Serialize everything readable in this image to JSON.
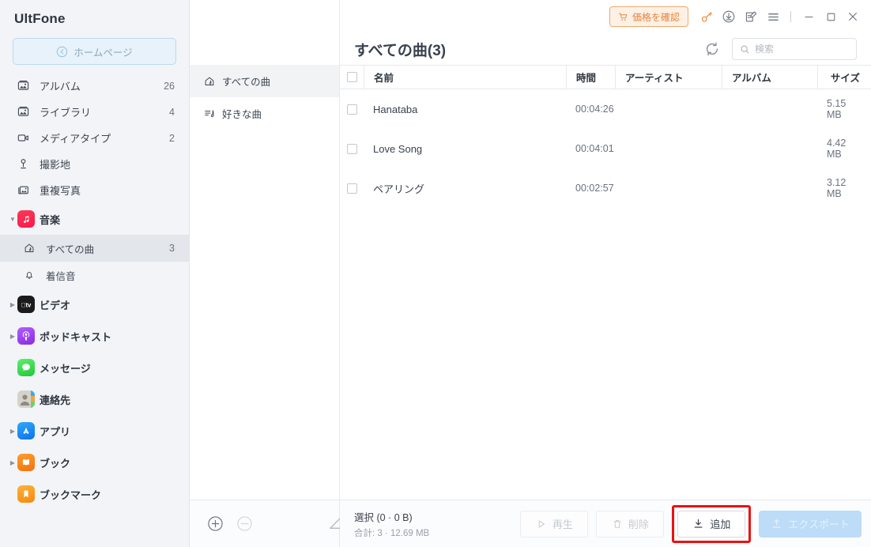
{
  "sidebar": {
    "brand": "UltFone",
    "home_button": {
      "label": "ホームページ",
      "icon": "back-circle-icon"
    },
    "items": [
      {
        "label": "アルバム",
        "count": "26",
        "icon": "photo-album-icon",
        "type": "plain"
      },
      {
        "label": "ライブラリ",
        "count": "4",
        "icon": "photo-library-icon",
        "type": "plain"
      },
      {
        "label": "メディアタイプ",
        "count": "2",
        "icon": "video-camera-icon",
        "type": "plain"
      },
      {
        "label": "撮影地",
        "count": "",
        "icon": "location-pin-icon",
        "type": "plain"
      },
      {
        "label": "重複写真",
        "count": "",
        "icon": "duplicate-photo-icon",
        "type": "plain"
      }
    ],
    "groups": [
      {
        "label": "音楽",
        "icon": "music-app-icon",
        "color": "#fa2d48",
        "expanded": true,
        "caret": "▼"
      },
      {
        "label": "ビデオ",
        "icon": "appletv-app-icon",
        "color": "#1b1b1d",
        "expanded": false,
        "caret": "▶"
      },
      {
        "label": "ポッドキャスト",
        "icon": "podcast-app-icon",
        "color": "#9b4dff",
        "expanded": false,
        "caret": "▶"
      },
      {
        "label": "メッセージ",
        "icon": "messages-app-icon",
        "color": "#46d55a",
        "expanded": false,
        "caret": ""
      },
      {
        "label": "連絡先",
        "icon": "contacts-app-icon",
        "color": "#c8c6bf",
        "expanded": false,
        "caret": ""
      },
      {
        "label": "アプリ",
        "icon": "appstore-app-icon",
        "color": "#1f8cf5",
        "expanded": false,
        "caret": "▶"
      },
      {
        "label": "ブック",
        "icon": "books-app-icon",
        "color": "#f2720c",
        "expanded": false,
        "caret": "▶"
      },
      {
        "label": "ブックマーク",
        "icon": "bookmark-app-icon",
        "color": "#f79a14",
        "expanded": false,
        "caret": ""
      }
    ],
    "music_children": [
      {
        "label": "すべての曲",
        "count": "3",
        "icon": "house-note-icon",
        "selected": true
      },
      {
        "label": "着信音",
        "count": "",
        "icon": "bell-icon",
        "selected": false
      }
    ]
  },
  "midpanel": {
    "items": [
      {
        "label": "すべての曲",
        "icon": "house-note-icon",
        "active": true
      },
      {
        "label": "好きな曲",
        "icon": "playlist-note-icon",
        "active": false
      }
    ],
    "bottom_actions": [
      {
        "name": "add-playlist-button",
        "icon": "plus-circle-icon",
        "enabled": true
      },
      {
        "name": "remove-playlist-button",
        "icon": "minus-circle-icon",
        "enabled": false
      },
      {
        "name": "edit-playlist-button",
        "icon": "pencil-icon",
        "enabled": true
      }
    ]
  },
  "titlebar": {
    "price_button": {
      "label": "価格を確認",
      "icon": "cart-icon",
      "color": "#e8833a"
    },
    "icons": [
      {
        "name": "key-icon",
        "glyph": "key"
      },
      {
        "name": "download-icon",
        "glyph": "download"
      },
      {
        "name": "feedback-icon",
        "glyph": "feedback"
      },
      {
        "name": "menu-icon",
        "glyph": "hamburger"
      }
    ],
    "window_controls": [
      {
        "name": "minimize-button",
        "glyph": "−"
      },
      {
        "name": "maximize-button",
        "glyph": "□"
      },
      {
        "name": "close-button",
        "glyph": "✕"
      }
    ]
  },
  "header": {
    "title": "すべての曲(3)",
    "refresh_icon": "refresh-icon",
    "search": {
      "placeholder": "検索",
      "value": "",
      "icon": "search-icon"
    }
  },
  "table": {
    "columns": [
      "名前",
      "時間",
      "アーティスト",
      "アルバム",
      "サイズ"
    ],
    "rows": [
      {
        "name": "Hanataba",
        "time": "00:04:26",
        "artist": "",
        "album": "",
        "size": "5.15 MB",
        "checked": false
      },
      {
        "name": "Love Song",
        "time": "00:04:01",
        "artist": "",
        "album": "",
        "size": "4.42 MB",
        "checked": false
      },
      {
        "name": "ペアリング",
        "time": "00:02:57",
        "artist": "",
        "album": "",
        "size": "3.12 MB",
        "checked": false
      }
    ]
  },
  "footer": {
    "selected_label": "選択 (0 · 0 B)",
    "total_label": "合計: 3 · 12.69 MB",
    "buttons": {
      "play": {
        "label": "再生",
        "icon": "play-icon",
        "enabled": false
      },
      "delete": {
        "label": "削除",
        "icon": "trash-icon",
        "enabled": false
      },
      "add": {
        "label": "追加",
        "icon": "import-icon",
        "enabled": true,
        "highlighted": true
      },
      "export": {
        "label": "エクスポート",
        "icon": "export-icon",
        "enabled": false
      }
    }
  }
}
